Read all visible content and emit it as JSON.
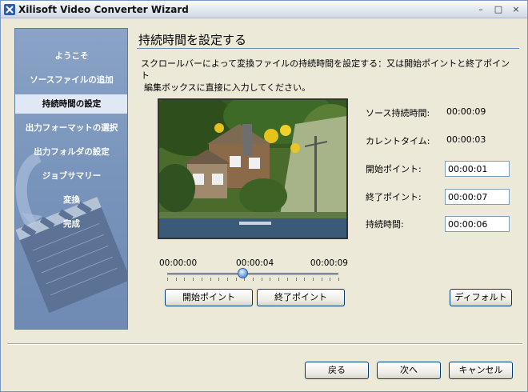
{
  "window": {
    "title": "Xilisoft Video Converter Wizard",
    "controls": {
      "minimize": "–",
      "maximize": "□",
      "close": "×"
    }
  },
  "sidebar": {
    "items": [
      {
        "label": "ようこそ",
        "active": false
      },
      {
        "label": "ソースファイルの追加",
        "active": false
      },
      {
        "label": "持続時間の設定",
        "active": true
      },
      {
        "label": "出力フォーマットの選択",
        "active": false
      },
      {
        "label": "出力フォルダの設定",
        "active": false
      },
      {
        "label": "ジョブサマリー",
        "active": false
      },
      {
        "label": "変換",
        "active": false
      },
      {
        "label": "完成",
        "active": false
      }
    ]
  },
  "main": {
    "title": "持続時間を設定する",
    "instruction_line1": "スクロールバーによって変換ファイルの持続時間を設定する：又は開始ポイントと終了ポイント",
    "instruction_line2": "編集ボックスに直接に入力してください。"
  },
  "timeline": {
    "start": "00:00:00",
    "current": "00:00:04",
    "end": "00:00:09",
    "position_fraction": 0.44
  },
  "info": {
    "source_duration_label": "ソース持続時間:",
    "source_duration_value": "00:00:09",
    "current_time_label": "カレントタイム:",
    "current_time_value": "00:00:03",
    "start_point_label": "開始ポイント:",
    "start_point_value": "00:00:01",
    "end_point_label": "終了ポイント:",
    "end_point_value": "00:00:07",
    "duration_label": "持続時間:",
    "duration_value": "00:00:06"
  },
  "buttons": {
    "start_point": "開始ポイント",
    "end_point": "終了ポイント",
    "default": "ディフォルト",
    "back": "戻る",
    "next": "次へ",
    "cancel": "キャンセル"
  },
  "colors": {
    "sidebar": "#7994bb",
    "accent_rule": "#6c8bbd",
    "active_item": "#dfe8f4"
  },
  "icons": {
    "app": "xilisoft-app-icon",
    "sidebar_art": "clapperboard-icon"
  }
}
